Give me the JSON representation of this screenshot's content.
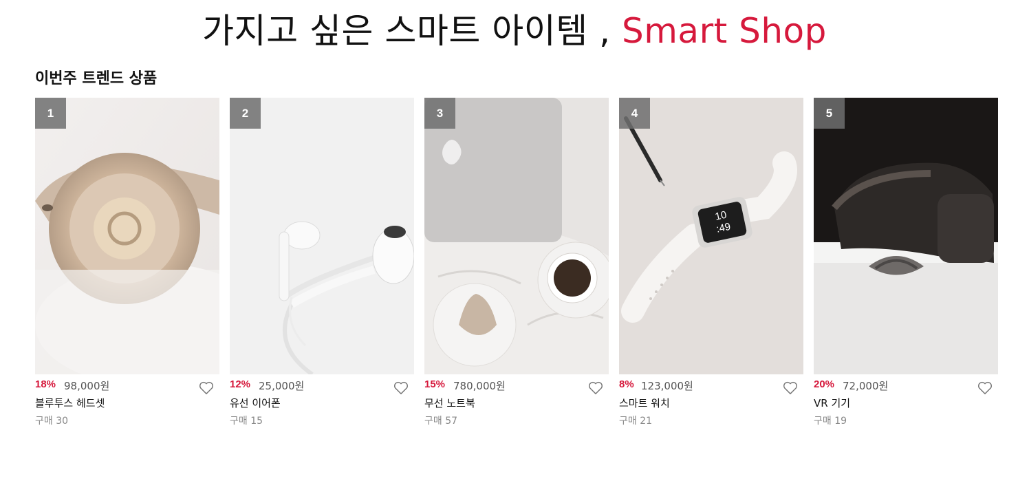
{
  "hero": {
    "title_main": "가지고 싶은 스마트 아이템 , ",
    "title_accent": "Smart Shop"
  },
  "section": {
    "title": "이번주 트렌드 상품"
  },
  "colors": {
    "accent": "#d6193c",
    "rank_badge": "#6e6e6e",
    "muted_text": "#888888"
  },
  "products": [
    {
      "rank": "1",
      "discount": "18%",
      "price": "98,000원",
      "name": "블루투스 헤드셋",
      "sales": "구매 30",
      "image": "headphones"
    },
    {
      "rank": "2",
      "discount": "12%",
      "price": "25,000원",
      "name": "유선 이어폰",
      "sales": "구매 15",
      "image": "earphones"
    },
    {
      "rank": "3",
      "discount": "15%",
      "price": "780,000원",
      "name": "무선 노트북",
      "sales": "구매 57",
      "image": "laptop-and-coffee"
    },
    {
      "rank": "4",
      "discount": "8%",
      "price": "123,000원",
      "name": "스마트 워치",
      "sales": "구매 21",
      "image": "smartwatch",
      "watch_time": "10\n:49"
    },
    {
      "rank": "5",
      "discount": "20%",
      "price": "72,000원",
      "name": "VR 기기",
      "sales": "구매 19",
      "image": "vr-headset"
    }
  ],
  "icons": {
    "wishlist": "heart-outline-icon"
  }
}
